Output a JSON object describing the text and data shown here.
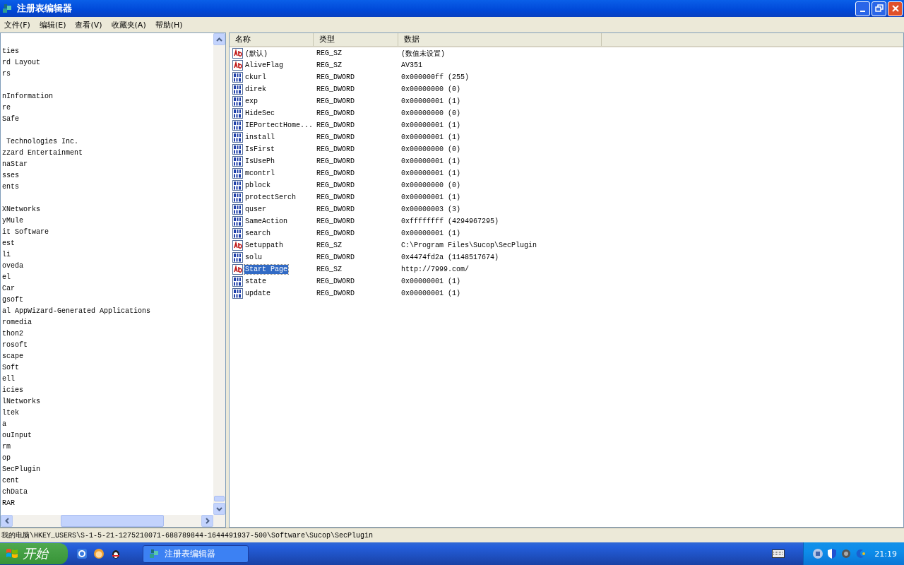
{
  "window": {
    "title": "注册表编辑器"
  },
  "menu": [
    "文件(F)",
    "编辑(E)",
    "查看(V)",
    "收藏夹(A)",
    "帮助(H)"
  ],
  "tree": {
    "groups": [
      [
        "ties",
        "rd Layout",
        "rs"
      ],
      [
        "nInformation",
        "re",
        "Safe"
      ],
      [
        " Technologies Inc.",
        "zzard Entertainment",
        "naStar",
        "sses",
        "ents"
      ],
      [
        "XNetworks",
        "yMule",
        "it Software",
        "est",
        "li",
        "oveda",
        "el",
        "Car",
        "gsoft",
        "al AppWizard-Generated Applications",
        "romedia",
        "thon2",
        "rosoft",
        "scape",
        "Soft",
        "ell",
        "icies",
        "lNetworks",
        "ltek",
        "a",
        "ouInput",
        "rm",
        "op",
        "SecPlugin",
        "cent",
        "chData",
        "RAR"
      ]
    ]
  },
  "table": {
    "columns": [
      "名称",
      "类型",
      "数据"
    ],
    "rows": [
      {
        "kind": "sz",
        "name": "(默认)",
        "type": "REG_SZ",
        "data": "(数值未设置)",
        "selected": false
      },
      {
        "kind": "sz",
        "name": "AliveFlag",
        "type": "REG_SZ",
        "data": "AV351",
        "selected": false
      },
      {
        "kind": "dword",
        "name": "ckurl",
        "type": "REG_DWORD",
        "data": "0x000000ff (255)",
        "selected": false
      },
      {
        "kind": "dword",
        "name": "direk",
        "type": "REG_DWORD",
        "data": "0x00000000 (0)",
        "selected": false
      },
      {
        "kind": "dword",
        "name": "exp",
        "type": "REG_DWORD",
        "data": "0x00000001 (1)",
        "selected": false
      },
      {
        "kind": "dword",
        "name": "HideSec",
        "type": "REG_DWORD",
        "data": "0x00000000 (0)",
        "selected": false
      },
      {
        "kind": "dword",
        "name": "IEPortectHome...",
        "type": "REG_DWORD",
        "data": "0x00000001 (1)",
        "selected": false
      },
      {
        "kind": "dword",
        "name": "install",
        "type": "REG_DWORD",
        "data": "0x00000001 (1)",
        "selected": false
      },
      {
        "kind": "dword",
        "name": "IsFirst",
        "type": "REG_DWORD",
        "data": "0x00000000 (0)",
        "selected": false
      },
      {
        "kind": "dword",
        "name": "IsUsePh",
        "type": "REG_DWORD",
        "data": "0x00000001 (1)",
        "selected": false
      },
      {
        "kind": "dword",
        "name": "mcontrl",
        "type": "REG_DWORD",
        "data": "0x00000001 (1)",
        "selected": false
      },
      {
        "kind": "dword",
        "name": "pblock",
        "type": "REG_DWORD",
        "data": "0x00000000 (0)",
        "selected": false
      },
      {
        "kind": "dword",
        "name": "protectSerch",
        "type": "REG_DWORD",
        "data": "0x00000001 (1)",
        "selected": false
      },
      {
        "kind": "dword",
        "name": "quser",
        "type": "REG_DWORD",
        "data": "0x00000003 (3)",
        "selected": false
      },
      {
        "kind": "dword",
        "name": "SameAction",
        "type": "REG_DWORD",
        "data": "0xffffffff (4294967295)",
        "selected": false
      },
      {
        "kind": "dword",
        "name": "search",
        "type": "REG_DWORD",
        "data": "0x00000001 (1)",
        "selected": false
      },
      {
        "kind": "sz",
        "name": "Setuppath",
        "type": "REG_SZ",
        "data": "C:\\Program Files\\Sucop\\SecPlugin",
        "selected": false
      },
      {
        "kind": "dword",
        "name": "solu",
        "type": "REG_DWORD",
        "data": "0x4474fd2a (1148517674)",
        "selected": false
      },
      {
        "kind": "sz",
        "name": "Start Page",
        "type": "REG_SZ",
        "data": "http://7999.com/",
        "selected": true
      },
      {
        "kind": "dword",
        "name": "state",
        "type": "REG_DWORD",
        "data": "0x00000001 (1)",
        "selected": false
      },
      {
        "kind": "dword",
        "name": "update",
        "type": "REG_DWORD",
        "data": "0x00000001 (1)",
        "selected": false
      }
    ]
  },
  "status_bar": "我的电脑\\HKEY_USERS\\S-1-5-21-1275210071-688789844-1644491937-500\\Software\\Sucop\\SecPlugin",
  "taskbar": {
    "start": "开始",
    "tasks": [
      {
        "label": "注册表编辑器",
        "selected": false
      }
    ],
    "clock": "21:19"
  }
}
